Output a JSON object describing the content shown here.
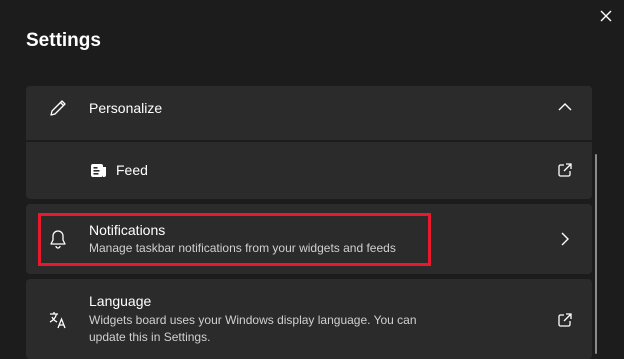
{
  "window": {
    "title": "Settings",
    "close_icon": "close-icon"
  },
  "sections": {
    "personalize": {
      "label": "Personalize",
      "icon": "pencil-icon",
      "toggle_icon": "chevron-up-icon",
      "expanded": true
    },
    "feed": {
      "label": "Feed",
      "icon": "feed-icon",
      "action_icon": "external-link-icon"
    },
    "notifications": {
      "label": "Notifications",
      "description": "Manage taskbar notifications from your widgets and feeds",
      "icon": "bell-icon",
      "action_icon": "chevron-right-icon"
    },
    "language": {
      "label": "Language",
      "description_line1": "Widgets board uses your Windows display language. You can",
      "description_line2": "update this in Settings.",
      "icon": "language-icon",
      "action_icon": "external-link-icon"
    }
  },
  "colors": {
    "background": "#1c1c1c",
    "card": "#2b2b2b",
    "highlight": "#e8192c"
  }
}
